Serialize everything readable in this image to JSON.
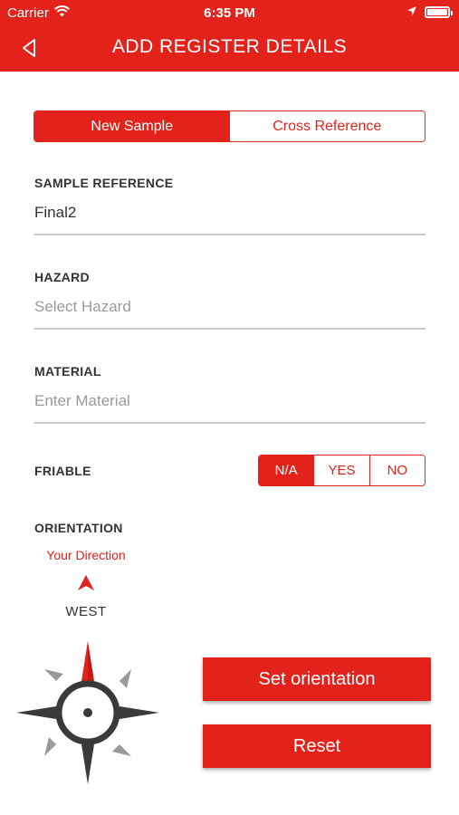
{
  "status_bar": {
    "carrier": "Carrier",
    "time": "6:35 PM"
  },
  "nav": {
    "title": "ADD REGISTER DETAILS",
    "back_icon": "chevron-left-icon"
  },
  "sample_type": {
    "options": [
      "New Sample",
      "Cross Reference"
    ],
    "selected": "New Sample"
  },
  "fields": {
    "sample_reference": {
      "label": "SAMPLE REFERENCE",
      "value": "Final2"
    },
    "hazard": {
      "label": "HAZARD",
      "placeholder": "Select Hazard"
    },
    "material": {
      "label": "MATERIAL",
      "placeholder": "Enter Material"
    }
  },
  "friable": {
    "label": "FRIABLE",
    "options": [
      "N/A",
      "YES",
      "NO"
    ],
    "selected": "N/A"
  },
  "orientation": {
    "label": "ORIENTATION",
    "direction_label": "Your Direction",
    "direction_value": "WEST",
    "set_button": "Set orientation",
    "reset_button": "Reset"
  },
  "colors": {
    "accent": "#e3231b",
    "compass": "#3a3a3a",
    "divider": "#c9c9c9"
  }
}
